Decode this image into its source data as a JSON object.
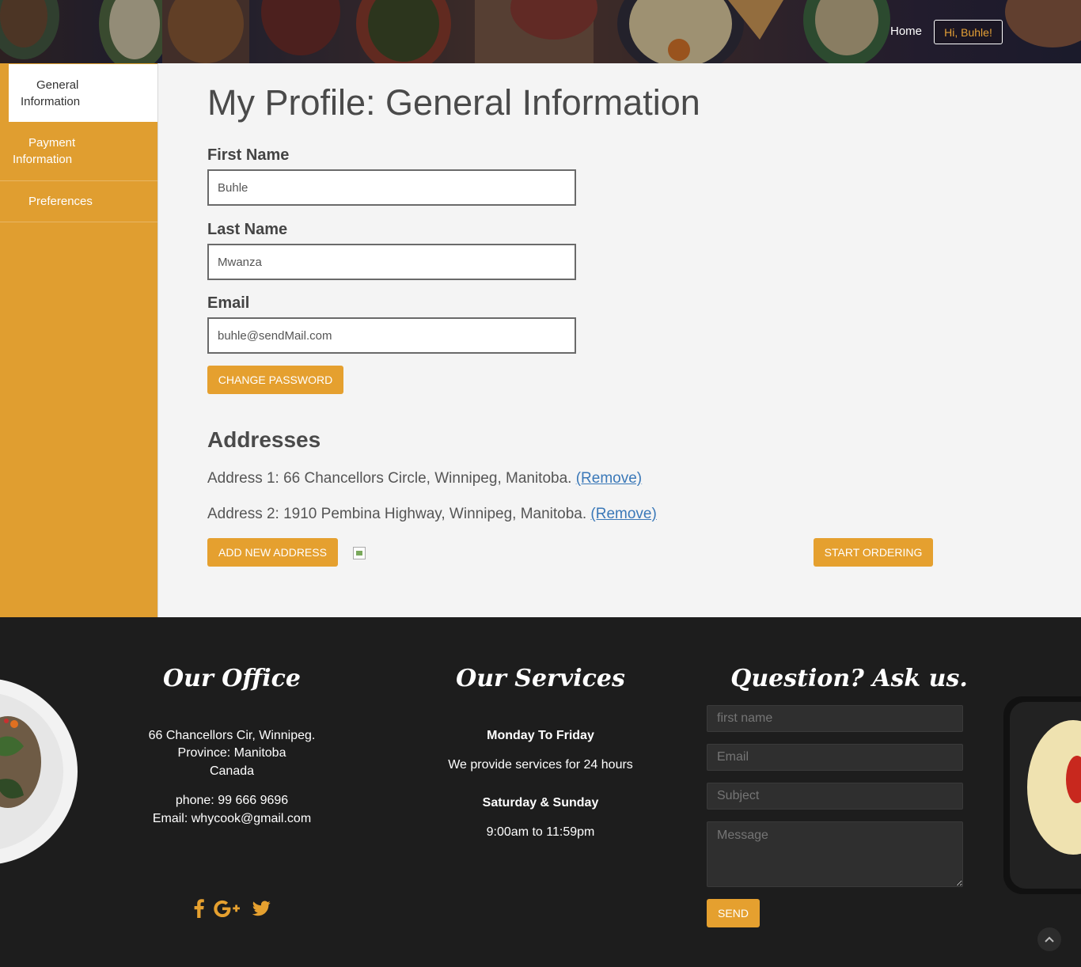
{
  "header": {
    "nav_home": "Home",
    "user_greeting": "Hi, Buhle!"
  },
  "sidebar": {
    "items": [
      {
        "line1": "General",
        "line2": "Information"
      },
      {
        "line1": "Payment",
        "line2": "Information"
      },
      {
        "line1": "Preferences",
        "line2": ""
      }
    ]
  },
  "profile": {
    "title": "My Profile: General Information",
    "first_name_label": "First Name",
    "first_name_value": "Buhle",
    "last_name_label": "Last Name",
    "last_name_value": "Mwanza",
    "email_label": "Email",
    "email_value": "buhle@sendMail.com",
    "change_password": "CHANGE PASSWORD"
  },
  "addresses": {
    "heading": "Addresses",
    "items": [
      {
        "text": "Address 1: 66 Chancellors Circle, Winnipeg, Manitoba.",
        "action": "(Remove)"
      },
      {
        "text": "Address 2: 1910 Pembina Highway, Winnipeg, Manitoba.",
        "action": "(Remove)"
      }
    ],
    "add_button": "ADD NEW ADDRESS",
    "start_button": "START ORDERING"
  },
  "footer": {
    "office": {
      "heading": "Our Office",
      "line1": "66 Chancellors Cir, Winnipeg.",
      "line2": "Province: Manitoba",
      "line3": "Canada",
      "phone": "phone: 99 666 9696",
      "email": "Email: whycook@gmail.com"
    },
    "services": {
      "heading": "Our Services",
      "weekday_title": "Monday To Friday",
      "weekday_text": "We provide services for 24 hours",
      "weekend_title": "Saturday & Sunday",
      "weekend_text": "9:00am to 11:59pm"
    },
    "contact": {
      "heading": "Question? Ask us.",
      "first_name_placeholder": "first name",
      "email_placeholder": "Email",
      "subject_placeholder": "Subject",
      "message_placeholder": "Message",
      "send": "SEND"
    },
    "social_icons": [
      "facebook-icon",
      "google-plus-icon",
      "twitter-icon"
    ]
  },
  "colors": {
    "accent": "#e5a02f",
    "sidebar": "#e09e30",
    "footer_bg": "#1d1d1d",
    "link": "#3a78b8"
  }
}
